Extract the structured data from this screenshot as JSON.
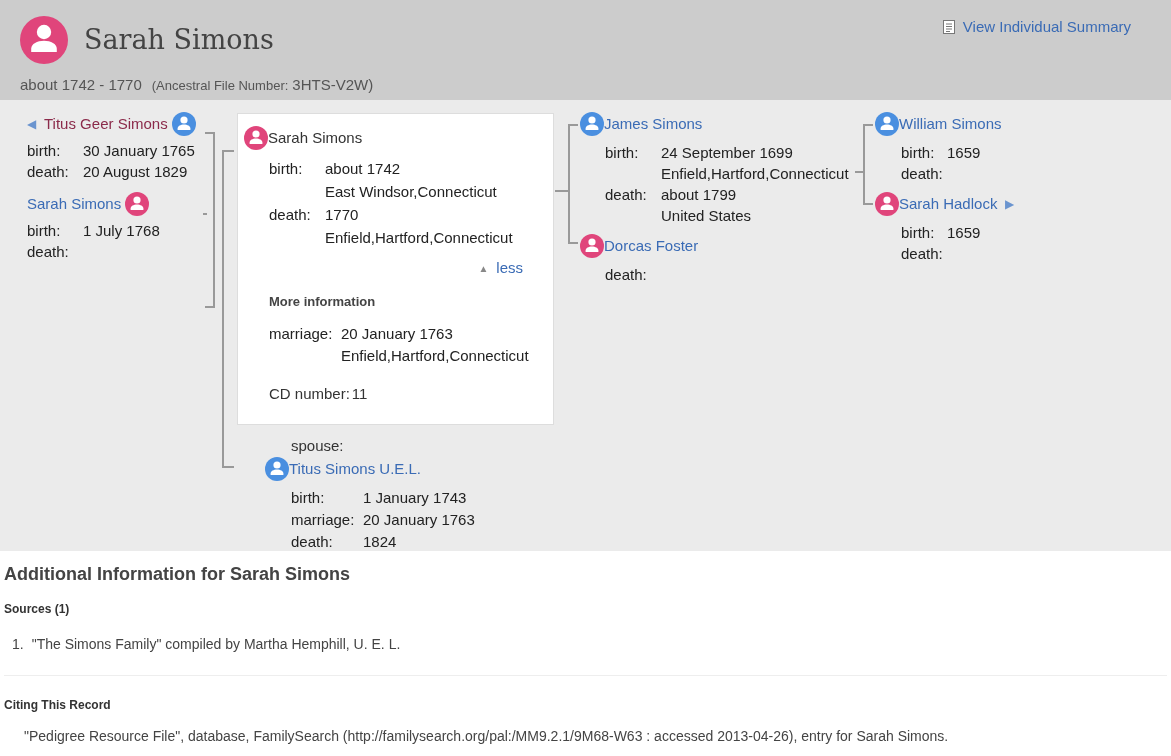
{
  "header": {
    "name": "Sarah Simons",
    "color": "#e0457b",
    "summary_link": "View Individual Summary",
    "lifespan": "about 1742 - 1770",
    "afn_label": "(Ancestral File Number:",
    "afn_value": "3HTS-V2W)"
  },
  "children": [
    {
      "name": "Titus Geer Simons",
      "color": "#4a8fe0",
      "visited": true,
      "expand_icon": "◀",
      "facts": [
        {
          "label": "birth:",
          "value": "30 January 1765"
        },
        {
          "label": "death:",
          "value": "20 August 1829"
        }
      ]
    },
    {
      "name": "Sarah Simons",
      "color": "#e0457b",
      "visited": false,
      "facts": [
        {
          "label": "birth:",
          "value": "1 July 1768"
        },
        {
          "label": "death:"
        }
      ]
    }
  ],
  "focus": {
    "name": "Sarah Simons",
    "color": "#e0457b",
    "facts": [
      {
        "label": "birth:",
        "value": "about 1742",
        "place": "East Windsor,Connecticut"
      },
      {
        "label": "death:",
        "value": "1770",
        "place": "Enfield,Hartford,Connecticut"
      }
    ],
    "toggle": {
      "icon": "▲",
      "label": "less",
      "expanded": true
    },
    "more_info": {
      "title": "More information",
      "facts": [
        {
          "label": "marriage:",
          "value": "20 January 1763",
          "place": "Enfield,Hartford,Connecticut"
        }
      ],
      "cd_label": "CD number:",
      "cd_value": "11"
    }
  },
  "spouse": {
    "label": "spouse:",
    "name": "Titus Simons U.E.L.",
    "color": "#4a8fe0",
    "visited": false,
    "facts": [
      {
        "label": "birth:",
        "value": "1 January 1743"
      },
      {
        "label": "marriage:",
        "value": "20 January 1763"
      },
      {
        "label": "death:",
        "value": "1824"
      }
    ]
  },
  "parents": [
    {
      "name": "James Simons",
      "color": "#4a8fe0",
      "visited": false,
      "facts": [
        {
          "label": "birth:",
          "value": "24 September 1699",
          "place": "Enfield,Hartford,Connecticut"
        },
        {
          "label": "death:",
          "value": "about 1799",
          "place": "United States"
        }
      ]
    },
    {
      "name": "Dorcas Foster",
      "color": "#e0457b",
      "visited": false,
      "facts": [
        {
          "label": "death:"
        }
      ]
    }
  ],
  "grandparents": [
    {
      "name": "William Simons",
      "color": "#4a8fe0",
      "visited": false,
      "facts": [
        {
          "label": "birth:",
          "value": "1659"
        },
        {
          "label": "death:"
        }
      ]
    },
    {
      "name": "Sarah Hadlock",
      "color": "#e0457b",
      "visited": false,
      "expand_icon": "▶",
      "facts": [
        {
          "label": "birth:",
          "value": "1659"
        },
        {
          "label": "death:"
        }
      ]
    }
  ],
  "additional": {
    "title": "Additional Information for Sarah Simons",
    "sources_title": "Sources (1)",
    "sources": [
      {
        "number": "1.",
        "text": "\"The Simons Family\" compiled by Martha Hemphill, U. E. L."
      }
    ],
    "citing_title": "Citing This Record",
    "citation": "\"Pedigree Resource File\", database, FamilySearch (http://familysearch.org/pal:/MM9.2.1/9M68-W63 : accessed 2013-04-26), entry for Sarah Simons."
  }
}
